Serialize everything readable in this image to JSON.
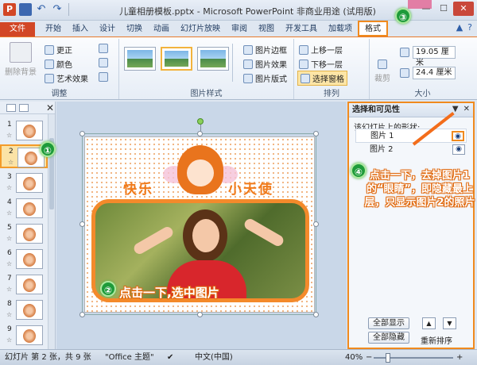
{
  "window": {
    "title": "儿童相册模板.pptx - Microsoft PowerPoint 非商业用途 (试用版)",
    "win_minimize": "—",
    "win_maximize": "☐",
    "win_close": "✕"
  },
  "qat": {
    "logo": "P",
    "undo": "↶",
    "redo": "↷"
  },
  "tabs": [
    "文件",
    "开始",
    "插入",
    "设计",
    "切换",
    "动画",
    "幻灯片放映",
    "审阅",
    "视图",
    "开发工具",
    "加载项",
    "格式"
  ],
  "help": {
    "up": "▲",
    "help": "?"
  },
  "ribbon": {
    "adjust": {
      "remove_bg": "删除背景",
      "correct": "更正",
      "color": "颜色",
      "art": "艺术效果",
      "label": "调整"
    },
    "styles": {
      "border": "图片边框",
      "effect": "图片效果",
      "layout": "图片版式",
      "label": "图片样式"
    },
    "arrange": {
      "bring_forward": "上移一层",
      "send_backward": "下移一层",
      "sel_pane": "选择窗格",
      "label": "排列"
    },
    "size": {
      "crop": "裁剪",
      "height": "19.05 厘米",
      "width": "24.4 厘米",
      "label": "大小"
    }
  },
  "thumbs": [
    {
      "num": "1",
      "star": "☆"
    },
    {
      "num": "2",
      "star": "☆"
    },
    {
      "num": "3",
      "star": "☆"
    },
    {
      "num": "4",
      "star": "☆"
    },
    {
      "num": "5",
      "star": "☆"
    },
    {
      "num": "6",
      "star": "☆"
    },
    {
      "num": "7",
      "star": "☆"
    },
    {
      "num": "8",
      "star": "☆"
    },
    {
      "num": "9",
      "star": "☆"
    }
  ],
  "slide": {
    "title_left": "快乐",
    "title_right": "小天使"
  },
  "callouts": {
    "b1": "①",
    "b2": "②",
    "b3": "③",
    "b4": "④",
    "step2": "点击一下,选中图片",
    "step4": "点击一下，去掉图片1的“眼睛”，即隐藏最上层，只显示图片2的照片"
  },
  "selection_pane": {
    "title": "选择和可见性",
    "dropdown": "▼",
    "close": "✕",
    "subtitle": "该幻灯片上的形状:",
    "shapes": [
      {
        "name": "图片 1",
        "eye": "◉"
      },
      {
        "name": "图片 2",
        "eye": "◉"
      }
    ],
    "show_all": "全部显示",
    "hide_all": "全部隐藏",
    "reorder": "重新排序",
    "move_up": "▲",
    "move_down": "▼"
  },
  "status": {
    "slide_info": "幻灯片 第 2 张，共 9 张",
    "theme": "\"Office 主题\"",
    "language": "中文(中国)",
    "zoom": "40%",
    "zoom_out": "−",
    "zoom_in": "+"
  },
  "colors": {
    "accent_orange": "#f08a1e",
    "file_tab": "#d24726",
    "badge_green": "#1e9b3a"
  }
}
